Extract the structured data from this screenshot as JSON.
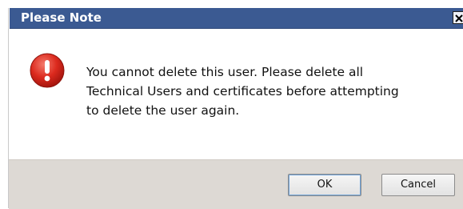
{
  "dialog": {
    "title": "Please Note",
    "icon": "error-icon",
    "message_lines": [
      "You cannot delete this user.  Please delete all",
      "Technical Users and certificates before attempting",
      "to delete the user again."
    ],
    "buttons": {
      "ok_label": "OK",
      "cancel_label": "Cancel"
    }
  },
  "colors": {
    "titlebar": "#3b5a92",
    "error_icon": "#d9261c",
    "footer": "#ddd9d4"
  }
}
